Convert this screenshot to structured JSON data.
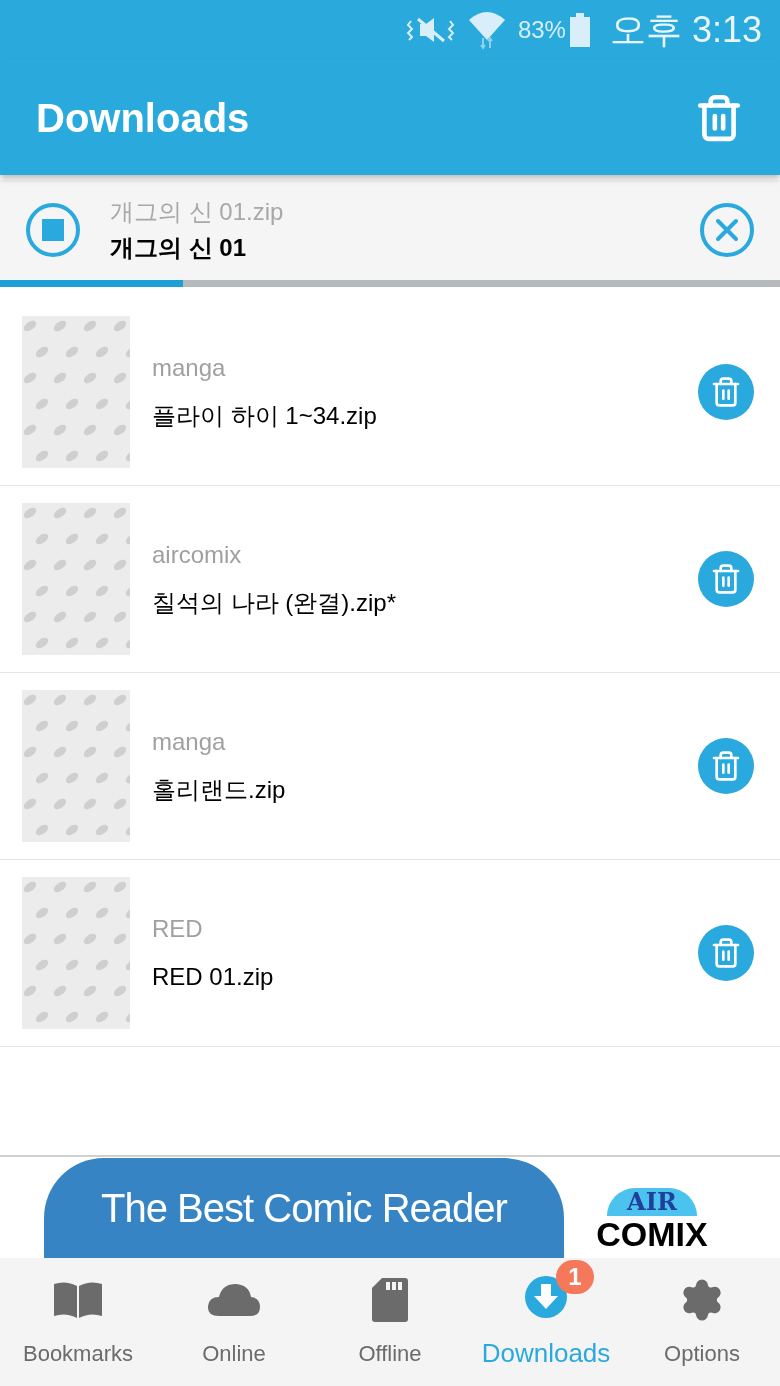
{
  "status_bar": {
    "battery": "83%",
    "time": "오후 3:13"
  },
  "app_bar": {
    "title": "Downloads"
  },
  "current_download": {
    "file": "개그의 신 01.zip",
    "title": "개그의 신 01",
    "level": 0.235
  },
  "items": [
    {
      "folder": "manga",
      "file": "플라이 하이 1~34.zip"
    },
    {
      "folder": "aircomix",
      "file": "칠석의 나라 (완결).zip*"
    },
    {
      "folder": "manga",
      "file": "홀리랜드.zip"
    },
    {
      "folder": "RED",
      "file": "RED 01.zip"
    }
  ],
  "ad": {
    "headline": "The Best Comic Reader",
    "logo_top": "AIR",
    "logo_bottom": "COMIX"
  },
  "nav": [
    {
      "kind": "book",
      "label": "Bookmarks",
      "selected": false
    },
    {
      "kind": "cloud",
      "label": "Online",
      "selected": false
    },
    {
      "kind": "sd",
      "label": "Offline",
      "selected": false
    },
    {
      "kind": "download",
      "label": "Downloads",
      "selected": true,
      "badge": "1"
    },
    {
      "kind": "gear",
      "label": "Options",
      "selected": false
    }
  ]
}
